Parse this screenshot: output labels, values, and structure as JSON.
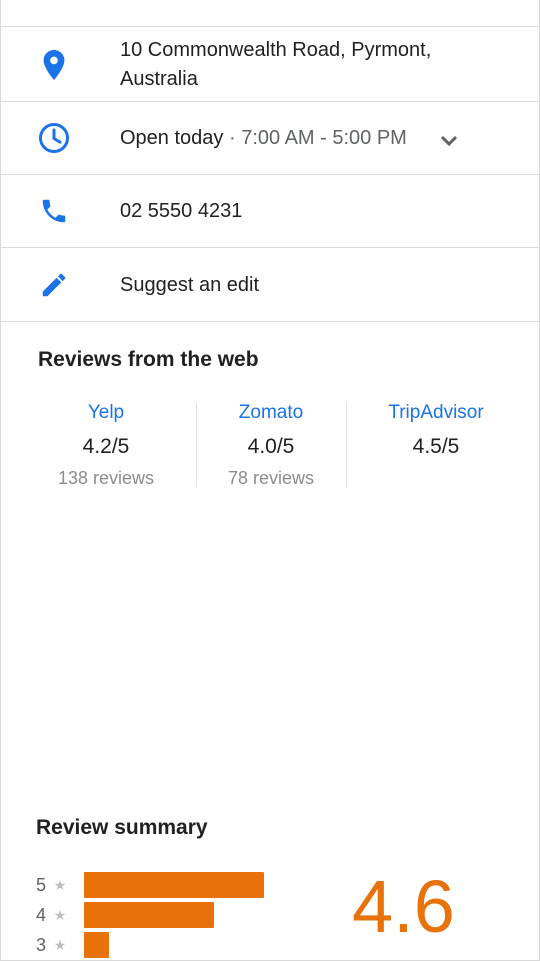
{
  "details": {
    "address": "10 Commonwealth Road, Pyrmont, Australia",
    "hours_status": "Open today",
    "hours_separator": " · ",
    "hours_range": "7:00 AM - 5:00 PM",
    "phone": "02 5550 4231",
    "suggest_edit": "Suggest an edit"
  },
  "icons": {
    "address": "location-pin-icon",
    "hours": "clock-icon",
    "expand": "chevron-down-icon",
    "phone": "phone-icon",
    "edit": "pencil-icon"
  },
  "reviews_web": {
    "title": "Reviews from the web",
    "sources": [
      {
        "name": "Yelp",
        "score": "4.2/5",
        "count": "138 reviews"
      },
      {
        "name": "Zomato",
        "score": "4.0/5",
        "count": "78 reviews"
      },
      {
        "name": "TripAdvisor",
        "score": "4.5/5",
        "count": ""
      }
    ]
  },
  "review_summary": {
    "title": "Review summary",
    "rating": "4.6",
    "star_glyph": "★",
    "distribution": [
      {
        "stars": "5",
        "fraction": 1.0
      },
      {
        "stars": "4",
        "fraction": 0.72
      },
      {
        "stars": "3",
        "fraction": 0.14
      }
    ]
  },
  "colors": {
    "accent_blue": "#1a73e8",
    "accent_orange": "#e8710a",
    "muted_text": "#5f6368",
    "divider": "#dcdcdc"
  }
}
